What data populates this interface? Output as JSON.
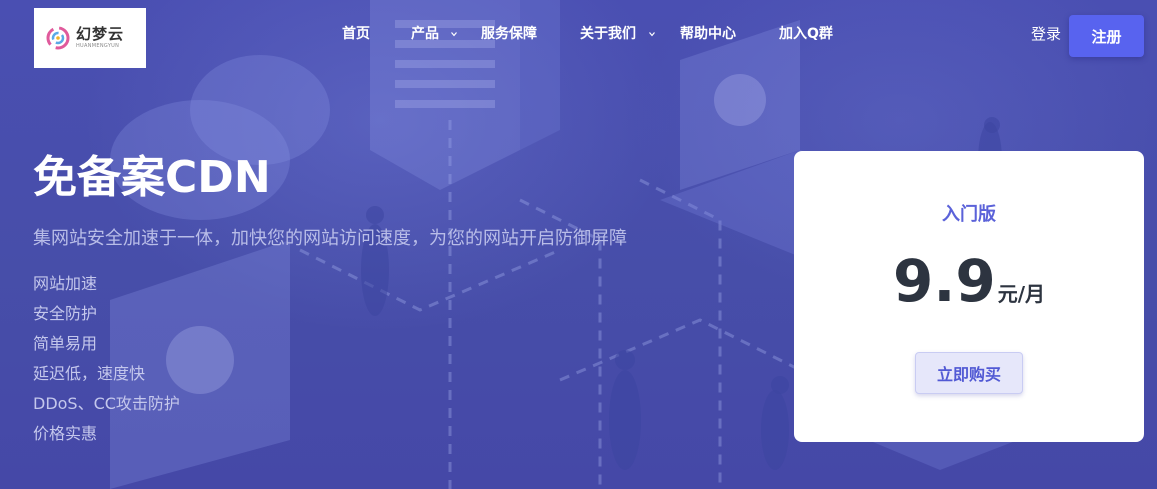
{
  "brand": {
    "logo_cn": "幻梦云",
    "logo_en": "HUANMENGYUN"
  },
  "nav": {
    "items": [
      {
        "label": "首页",
        "has_dropdown": false
      },
      {
        "label": "产品",
        "has_dropdown": true
      },
      {
        "label": "服务保障",
        "has_dropdown": false
      },
      {
        "label": "关于我们",
        "has_dropdown": true
      },
      {
        "label": "帮助中心",
        "has_dropdown": false
      },
      {
        "label": "加入Q群",
        "has_dropdown": false
      }
    ],
    "login_label": "登录",
    "register_label": "注册"
  },
  "hero": {
    "title": "免备案CDN",
    "subtitle": "集网站安全加速于一体，加快您的网站访问速度，为您的网站开启防御屏障",
    "features": [
      "网站加速",
      "安全防护",
      "简单易用",
      "延迟低，速度快",
      "DDoS、CC攻击防护",
      "价格实惠"
    ]
  },
  "price_card": {
    "plan_name": "入门版",
    "price": "9.9",
    "unit": "元/月",
    "buy_label": "立即购买"
  },
  "colors": {
    "background": "#4a51b3",
    "accent": "#5863ef",
    "plan_text": "#5b62d9",
    "price_text": "#2d3440"
  }
}
